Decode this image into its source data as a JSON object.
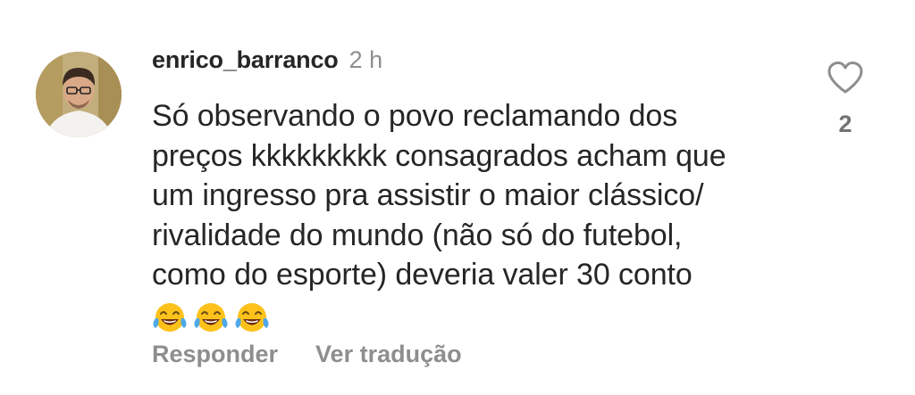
{
  "comment": {
    "username": "enrico_barranco",
    "time": "2 h",
    "text_lines": [
      "Só observando o povo reclamando dos",
      "preços kkkkkkkkk consagrados acham que",
      "um ingresso pra assistir o maior clássico/",
      "rivalidade do mundo (não só do futebol,",
      "como do esporte) deveria valer 30 conto"
    ],
    "emojis": [
      "face-with-tears-of-joy",
      "face-with-tears-of-joy",
      "face-with-tears-of-joy"
    ],
    "like_count": "2",
    "like_icon": "heart-outline-icon"
  },
  "actions": {
    "reply_label": "Responder",
    "translate_label": "Ver tradução"
  },
  "colors": {
    "text_primary": "#262626",
    "text_secondary": "#8e8e8e",
    "emoji_yellow": "#fcc21b",
    "emoji_tears": "#4fa8e8"
  }
}
